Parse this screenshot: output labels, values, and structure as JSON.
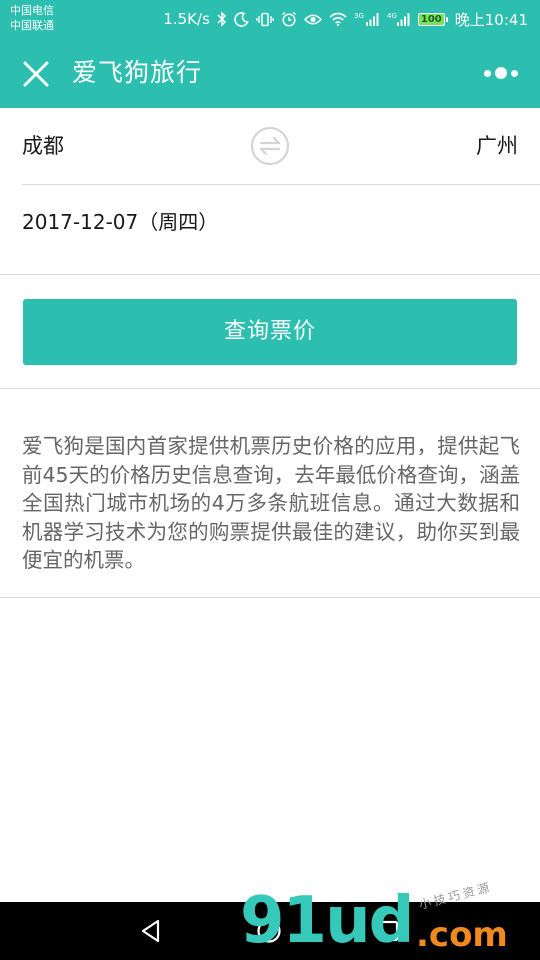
{
  "status_bar": {
    "carrier_1": "中国电信",
    "carrier_2": "中国联通",
    "net_speed": "1.5K/s",
    "signal_label_1": "3G",
    "signal_label_2": "4G",
    "battery": "100",
    "time": "晚上10:41"
  },
  "app_bar": {
    "title": "爱飞狗旅行"
  },
  "search_form": {
    "from_city": "成都",
    "to_city": "广州",
    "date": "2017-12-07（周四）",
    "search_label": "查询票价"
  },
  "description": "爱飞狗是国内首家提供机票历史价格的应用，提供起飞前45天的价格历史信息查询，去年最低价格查询，涵盖全国热门城市机场的4万多条航班信息。通过大数据和机器学习技术为您的购票提供最佳的建议，助你买到最便宜的机票。",
  "watermark": {
    "main": "91ud",
    "suffix": ".com",
    "small_text": "小技巧资源"
  },
  "colors": {
    "primary": "#2cbfaf",
    "divider": "#dcdcdc",
    "text_secondary": "#666666"
  }
}
